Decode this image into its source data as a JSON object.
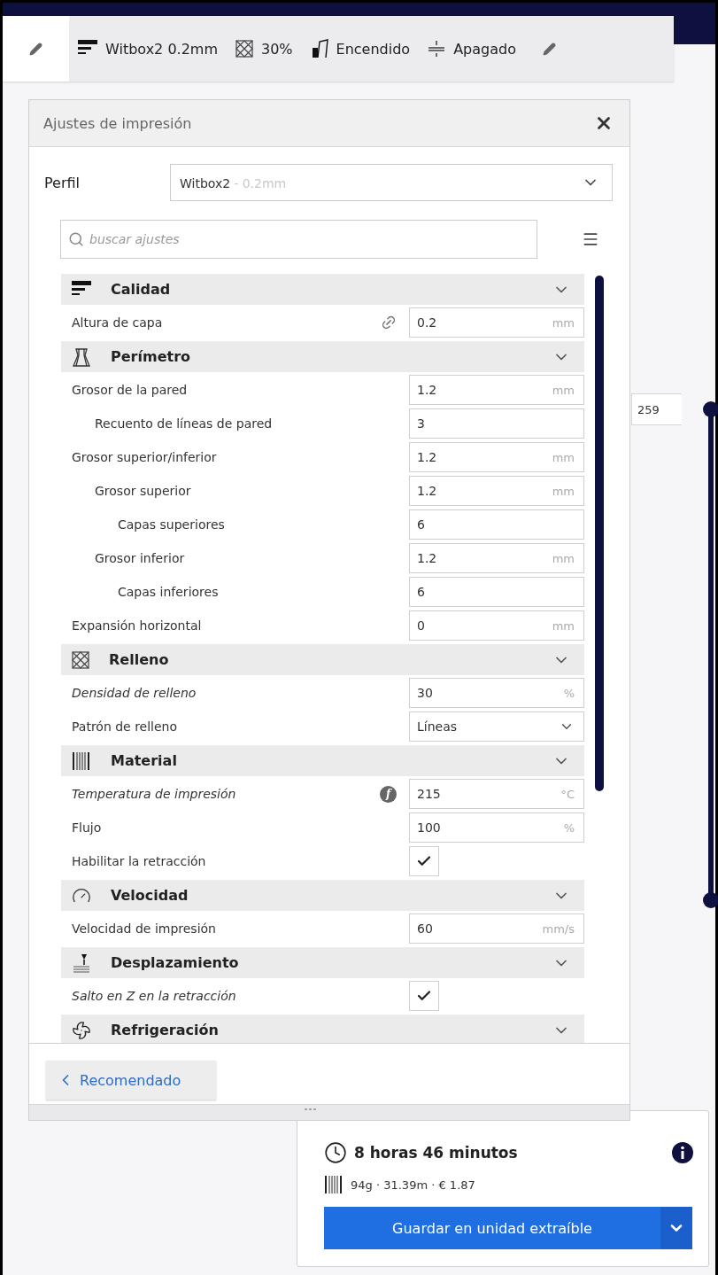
{
  "toolbar": {
    "items": [
      {
        "kind": "edit"
      },
      {
        "kind": "quality",
        "label": "Witbox2 0.2mm"
      },
      {
        "kind": "infill",
        "label": "30%"
      },
      {
        "kind": "support",
        "label": "Encendido"
      },
      {
        "kind": "adhesion",
        "label": "Apagado"
      },
      {
        "kind": "edit"
      }
    ]
  },
  "panel": {
    "title": "Ajustes de impresión",
    "profile": {
      "label": "Perfil",
      "value": "Witbox2",
      "detail": "- 0.2mm"
    },
    "search": {
      "placeholder": "buscar ajustes"
    },
    "sections": [
      {
        "kind": "quality",
        "title": "Calidad",
        "settings": [
          {
            "kind": "number",
            "label": "Altura de capa",
            "value": "0.2",
            "unit": "mm",
            "modified": false,
            "linked": true
          }
        ]
      },
      {
        "kind": "perimeter",
        "title": "Perímetro",
        "settings": [
          {
            "kind": "number",
            "label": "Grosor de la pared",
            "value": "1.2",
            "unit": "mm",
            "modified": false,
            "children": [
              {
                "kind": "number",
                "label": "Recuento de líneas de pared",
                "value": "3",
                "modified": false
              }
            ]
          },
          {
            "kind": "number",
            "label": "Grosor superior/inferior",
            "value": "1.2",
            "unit": "mm",
            "modified": false,
            "children": [
              {
                "kind": "number",
                "label": "Grosor superior",
                "value": "1.2",
                "unit": "mm",
                "modified": false,
                "children": [
                  {
                    "kind": "number",
                    "label": "Capas superiores",
                    "value": "6",
                    "modified": false
                  }
                ]
              },
              {
                "kind": "number",
                "label": "Grosor inferior",
                "value": "1.2",
                "unit": "mm",
                "modified": false,
                "children": [
                  {
                    "kind": "number",
                    "label": "Capas inferiores",
                    "value": "6",
                    "modified": false
                  }
                ]
              }
            ]
          },
          {
            "kind": "number",
            "label": "Expansión horizontal",
            "value": "0",
            "unit": "mm",
            "modified": false
          }
        ]
      },
      {
        "kind": "infill",
        "title": "Relleno",
        "settings": [
          {
            "kind": "number",
            "label": "Densidad de relleno",
            "value": "30",
            "unit": "%",
            "modified": true
          },
          {
            "kind": "dropdown",
            "label": "Patrón de relleno",
            "value": "Líneas",
            "modified": false
          }
        ]
      },
      {
        "kind": "material",
        "title": "Material",
        "settings": [
          {
            "kind": "number",
            "label": "Temperatura de impresión",
            "value": "215",
            "unit": "°C",
            "modified": true,
            "badge": "f"
          },
          {
            "kind": "number",
            "label": "Flujo",
            "value": "100",
            "unit": "%",
            "modified": false
          },
          {
            "kind": "checkbox",
            "label": "Habilitar la retracción",
            "checked": true,
            "modified": false
          }
        ]
      },
      {
        "kind": "speed",
        "title": "Velocidad",
        "settings": [
          {
            "kind": "number",
            "label": "Velocidad de impresión",
            "value": "60",
            "unit": "mm/s",
            "modified": false
          }
        ]
      },
      {
        "kind": "travel",
        "title": "Desplazamiento",
        "settings": [
          {
            "kind": "checkbox",
            "label": "Salto en Z en la retracción",
            "checked": true,
            "modified": true
          }
        ]
      },
      {
        "kind": "cooling",
        "title": "Refrigeración"
      }
    ],
    "footer_button": "Recomendado"
  },
  "layer_slider": {
    "label": "259"
  },
  "summary": {
    "time": "8 horas 46 minutos",
    "material": "94g · 31.39m · € 1.87",
    "button": "Guardar en unidad extraíble"
  }
}
